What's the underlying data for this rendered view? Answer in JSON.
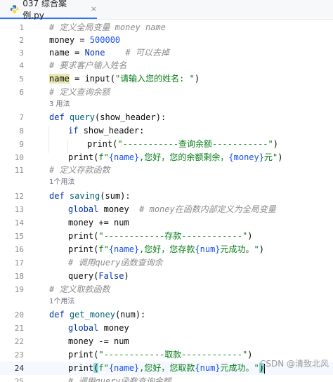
{
  "tab": {
    "title": "037 综合案例.py",
    "close": "×",
    "icon": "python-icon"
  },
  "watermark": "CSDN @清致北风",
  "hints": {
    "query_usages": "3 用法",
    "saving_usages": "1个用法",
    "get_money_usages": "1个用法"
  },
  "lines": {
    "l1": {
      "num": "1",
      "c1": "# 定义全局变量 money name"
    },
    "l2": {
      "num": "2",
      "c1": "money = ",
      "c2": "500000"
    },
    "l3": {
      "num": "3",
      "c1": "name = ",
      "c2": "None",
      "c3": "    # 可以去掉"
    },
    "l4": {
      "num": "4",
      "c1": "# 要求客户输入姓名"
    },
    "l5": {
      "num": "5",
      "c1": "name",
      "c2": " = input(",
      "c3": "\"请输入您的姓名: \"",
      "c4": ")"
    },
    "l6": {
      "num": "6",
      "c1": "# 定义查询余额"
    },
    "l7": {
      "num": "7",
      "c1": "def ",
      "c2": "query",
      "c3": "(show_header):"
    },
    "l8": {
      "num": "8",
      "c1": "if ",
      "c2": "show_header:"
    },
    "l9": {
      "num": "9",
      "c1": "print(",
      "c2": "\"-----------查询余额-----------\"",
      "c3": ")"
    },
    "l10": {
      "num": "10",
      "c1": "print(",
      "c2": "f\"",
      "c3": "{name}",
      "c4": ",您好，您的余额剩余，",
      "c5": "{money}",
      "c6": "元\"",
      "c7": ")"
    },
    "l11": {
      "num": "11",
      "c1": "# 定义存款函数"
    },
    "l12": {
      "num": "12",
      "c1": "def ",
      "c2": "saving",
      "c3": "(sum):"
    },
    "l13": {
      "num": "13",
      "c1": "global ",
      "c2": "money",
      "c3": "  # money在函数内部定义为全局变量"
    },
    "l14": {
      "num": "14",
      "c1": "money += num"
    },
    "l15": {
      "num": "15",
      "c1": "print(",
      "c2": "\"------------存款------------\"",
      "c3": ")"
    },
    "l16": {
      "num": "16",
      "c1": "print(",
      "c2": "f\"",
      "c3": "{name}",
      "c4": ",您好，您存款",
      "c5": "{num}",
      "c6": "元成功。\"",
      "c7": ")"
    },
    "l17": {
      "num": "17",
      "c1": "# 调用query函数查询余"
    },
    "l18": {
      "num": "18",
      "c1": "query(",
      "c2": "False",
      "c3": ")"
    },
    "l19": {
      "num": "19",
      "c1": "# 定义取款函数"
    },
    "l20": {
      "num": "20",
      "c1": "def ",
      "c2": "get_money",
      "c3": "(num):"
    },
    "l21": {
      "num": "21",
      "c1": "global ",
      "c2": "money"
    },
    "l22": {
      "num": "22",
      "c1": "money -= num"
    },
    "l23": {
      "num": "23",
      "c1": "print(",
      "c2": "\"------------取款------------\"",
      "c3": ")"
    },
    "l24": {
      "num": "24",
      "c1": "print",
      "c2": "(",
      "c3": "f\"",
      "c4": "{name}",
      "c5": ",您好，您取款",
      "c6": "{num}",
      "c7": "元成功。\"",
      "c8": ")"
    },
    "l25": {
      "num": "25",
      "c1": "# 调用query函数查询余额"
    }
  }
}
